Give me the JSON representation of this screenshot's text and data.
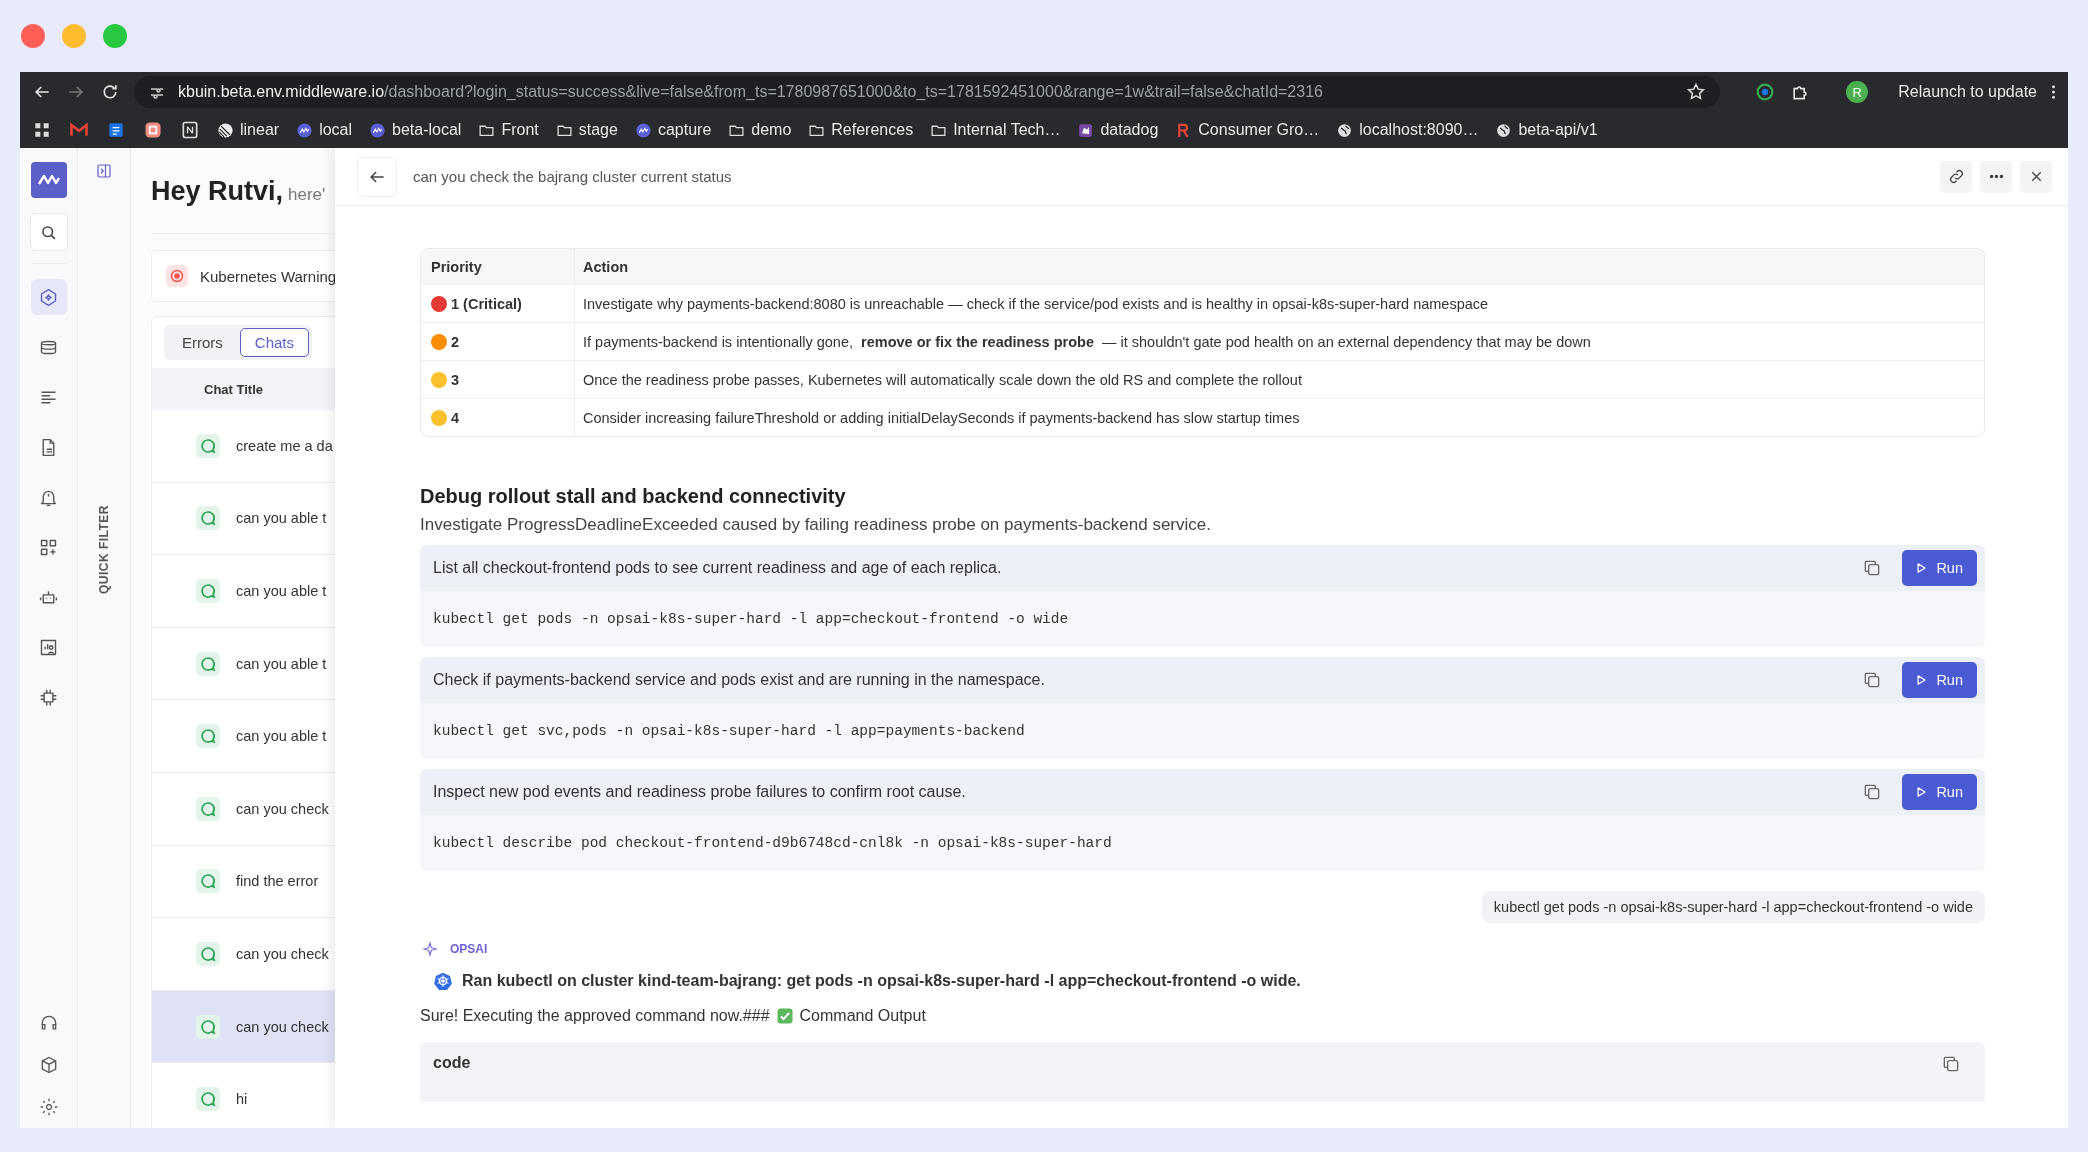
{
  "browser": {
    "url_host": "kbuin.beta.env.middleware.io",
    "url_path": "/dashboard?login_status=success&live=false&from_ts=1780987651000&to_ts=1781592451000&range=1w&trail=false&chatId=2316",
    "profile_initial": "R",
    "relaunch_label": "Relaunch to update"
  },
  "bookmarks": [
    {
      "kind": "linear",
      "label": "linear"
    },
    {
      "kind": "middleware",
      "label": "local"
    },
    {
      "kind": "middleware",
      "label": "beta-local"
    },
    {
      "kind": "folder",
      "label": "Front"
    },
    {
      "kind": "folder",
      "label": "stage"
    },
    {
      "kind": "middleware",
      "label": "capture"
    },
    {
      "kind": "folder",
      "label": "demo"
    },
    {
      "kind": "folder",
      "label": "References"
    },
    {
      "kind": "folder",
      "label": "Internal Tech…"
    },
    {
      "kind": "datadog",
      "label": "datadog"
    },
    {
      "kind": "rlogo",
      "label": "Consumer Gro…"
    },
    {
      "kind": "globe",
      "label": "localhost:8090…"
    },
    {
      "kind": "globe",
      "label": "beta-api/v1"
    }
  ],
  "rail": {
    "items": [
      {
        "selected": true
      },
      {
        "selected": false
      },
      {
        "selected": false
      },
      {
        "selected": false
      },
      {
        "selected": false
      },
      {
        "selected": false
      },
      {
        "selected": false
      },
      {
        "selected": false
      },
      {
        "selected": false
      }
    ]
  },
  "quick_filter": {
    "label": "QUICK FILTER"
  },
  "home": {
    "greeting": "Hey Rutvi,",
    "greeting_sub": "here'",
    "alert": "Kubernetes Warning",
    "tabs": [
      {
        "label": "Errors",
        "selected": false
      },
      {
        "label": "Chats",
        "selected": true
      }
    ],
    "column": "Chat Title",
    "chats": [
      {
        "title": "create me a da",
        "selected": false
      },
      {
        "title": "can you able t",
        "selected": false
      },
      {
        "title": "can you able t",
        "selected": false
      },
      {
        "title": "can you able t",
        "selected": false
      },
      {
        "title": "can you able t",
        "selected": false
      },
      {
        "title": "can you check",
        "selected": false
      },
      {
        "title": "find the error",
        "selected": false
      },
      {
        "title": "can you check",
        "selected": false
      },
      {
        "title": "can you check",
        "selected": true
      },
      {
        "title": "hi",
        "selected": false
      }
    ]
  },
  "drawer": {
    "title": "can you check the bajrang cluster current status",
    "fixes_table": {
      "columns": [
        "Priority",
        "Action"
      ],
      "rows": [
        {
          "priority": "1 (Critical)",
          "color": "#e53935",
          "action": "Investigate why payments-backend:8080 is unreachable — check if the service/pod exists and is healthy in opsai-k8s-super-hard namespace"
        },
        {
          "priority": "2",
          "color": "#fb8c00",
          "action": "If payments-backend is intentionally gone, **remove or fix the readiness probe** — it shouldn't gate pod health on an external dependency that may be down"
        },
        {
          "priority": "3",
          "color": "#fbc02d",
          "action": "Once the readiness probe passes, Kubernetes will automatically scale down the old RS and complete the rollout"
        },
        {
          "priority": "4",
          "color": "#fbc02d",
          "action": "Consider increasing failureThreshold or adding initialDelaySeconds if payments-backend has slow startup times"
        }
      ]
    },
    "section_title": "Debug rollout stall and backend connectivity",
    "section_subtitle": "Investigate ProgressDeadlineExceeded caused by failing readiness probe on payments-backend service.",
    "commands": [
      {
        "description": "List all checkout-frontend pods to see current readiness and age of each replica.",
        "command": "kubectl get pods -n opsai-k8s-super-hard -l app=checkout-frontend -o wide",
        "run_label": "Run"
      },
      {
        "description": "Check if payments-backend service and pods exist and are running in the namespace.",
        "command": "kubectl get svc,pods -n opsai-k8s-super-hard -l app=payments-backend",
        "run_label": "Run"
      },
      {
        "description": "Inspect new pod events and readiness probe failures to confirm root cause.",
        "command": "kubectl describe pod checkout-frontend-d9b6748cd-cnl8k -n opsai-k8s-super-hard",
        "run_label": "Run"
      }
    ],
    "user_message": "kubectl get pods -n opsai-k8s-super-hard -l app=checkout-frontend -o wide",
    "assistant": {
      "name": "OPSAI",
      "tool_call": "Ran kubectl on cluster kind-team-bajrang: get pods -n opsai-k8s-super-hard -l app=checkout-frontend -o wide.",
      "reply_before": "Sure! Executing the approved command now.###",
      "reply_after": "Command Output",
      "code_title": "code"
    }
  }
}
